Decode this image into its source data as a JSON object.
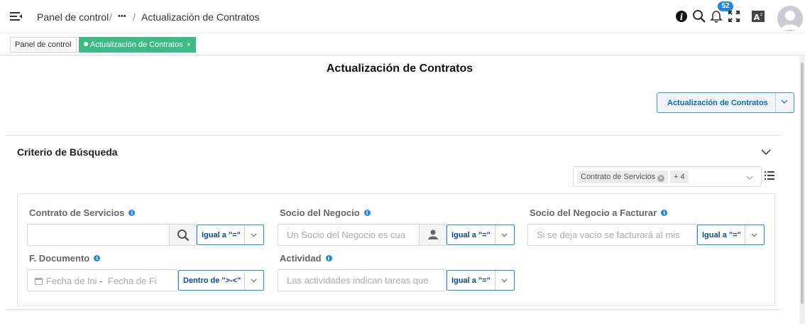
{
  "header": {
    "breadcrumb_home": "Panel de control",
    "breadcrumb_sep1": "/",
    "breadcrumb_more": "•••",
    "breadcrumb_sep2": "/",
    "breadcrumb_current": "Actualización de Contratos",
    "notification_count": "52",
    "icons": [
      "menu-icon",
      "info-icon",
      "search-icon",
      "bell-icon",
      "fullscreen-icon",
      "translate-icon",
      "avatar-icon"
    ]
  },
  "tabs": [
    {
      "label": "Panel de control",
      "active": false
    },
    {
      "label": "Actualización de Contratos",
      "active": true,
      "close": "×"
    }
  ],
  "page": {
    "title": "Actualización de Contratos",
    "action_button": "Actualización de Contratos"
  },
  "criteria": {
    "title": "Criterio de Búsqueda",
    "filter_chip": "Contrato de Servicios",
    "filter_more": "+ 4",
    "fields": {
      "contrato": {
        "label": "Contrato de Servicios",
        "value": "",
        "placeholder": "",
        "operator": "Igual a \"=\""
      },
      "socio": {
        "label": "Socio del Negocio",
        "placeholder": "Un Socio del Negocio es cua",
        "operator": "Igual a \"=\""
      },
      "socio_facturar": {
        "label": "Socio del Negocio a Facturar",
        "placeholder": "Si se deja vacío se facturará al mis",
        "operator": "Igual a \"=\""
      },
      "fecha": {
        "label": "F. Documento",
        "from_placeholder": "Fecha de Ini",
        "separator": "-",
        "to_placeholder": "Fecha de Fi",
        "operator": "Dentro de \">-<\""
      },
      "actividad": {
        "label": "Actividad",
        "placeholder": "Las actividades indican tareas que",
        "operator": "Igual a \"=\""
      }
    }
  },
  "colors": {
    "accent": "#1e88e5",
    "tab_active": "#3dbb87",
    "badge": "#1e88e5"
  }
}
